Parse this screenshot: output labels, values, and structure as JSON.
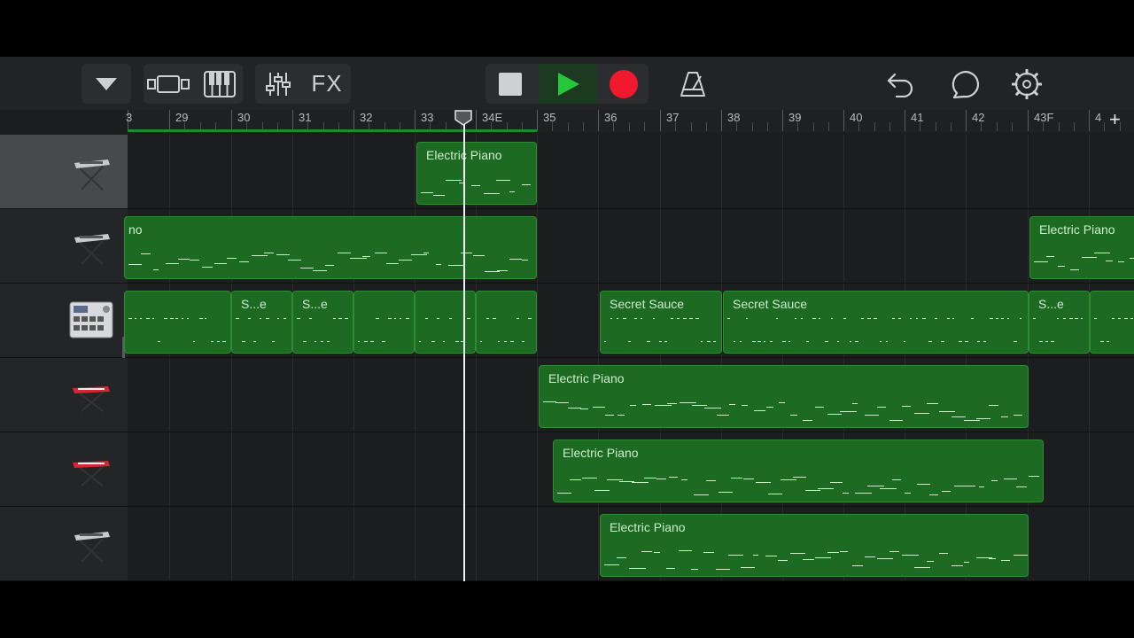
{
  "toolbar": {
    "fx_label": "FX",
    "icons": [
      "dropdown-triangle-icon",
      "tracks-view-icon",
      "keyboard-icon",
      "mixer-icon",
      "stop-icon",
      "play-icon",
      "record-icon",
      "metronome-icon",
      "undo-icon",
      "loop-icon",
      "settings-icon"
    ],
    "colors": {
      "play": "#24c83a",
      "record": "#f0192e",
      "region": "#1d6a22"
    }
  },
  "ruler": {
    "bars": [
      "29",
      "30",
      "31",
      "32",
      "33",
      "34E",
      "35",
      "36",
      "37",
      "38",
      "39",
      "40",
      "41",
      "42",
      "43F"
    ],
    "add_label": "+"
  },
  "tracks": [
    {
      "instrument": "synth-keyboard-icon",
      "selected": true,
      "regions": [
        {
          "label": "Electric Piano"
        }
      ]
    },
    {
      "instrument": "synth-keyboard-icon",
      "selected": false,
      "regions": [
        {
          "label": "no"
        },
        {
          "label": "Electric Piano"
        }
      ]
    },
    {
      "instrument": "drum-machine-icon",
      "selected": false,
      "regions": [
        {
          "label": ""
        },
        {
          "label": "S...e"
        },
        {
          "label": "S...e"
        },
        {
          "label": ""
        },
        {
          "label": ""
        },
        {
          "label": ""
        },
        {
          "label": "Secret Sauce"
        },
        {
          "label": "Secret Sauce"
        },
        {
          "label": "S...e"
        },
        {
          "label": ""
        }
      ]
    },
    {
      "instrument": "red-keyboard-icon",
      "selected": false,
      "regions": [
        {
          "label": "Electric Piano"
        }
      ]
    },
    {
      "instrument": "red-keyboard-icon",
      "selected": false,
      "regions": [
        {
          "label": "Electric Piano"
        }
      ]
    },
    {
      "instrument": "synth-keyboard-icon",
      "selected": false,
      "regions": [
        {
          "label": "Electric Piano"
        }
      ]
    }
  ]
}
